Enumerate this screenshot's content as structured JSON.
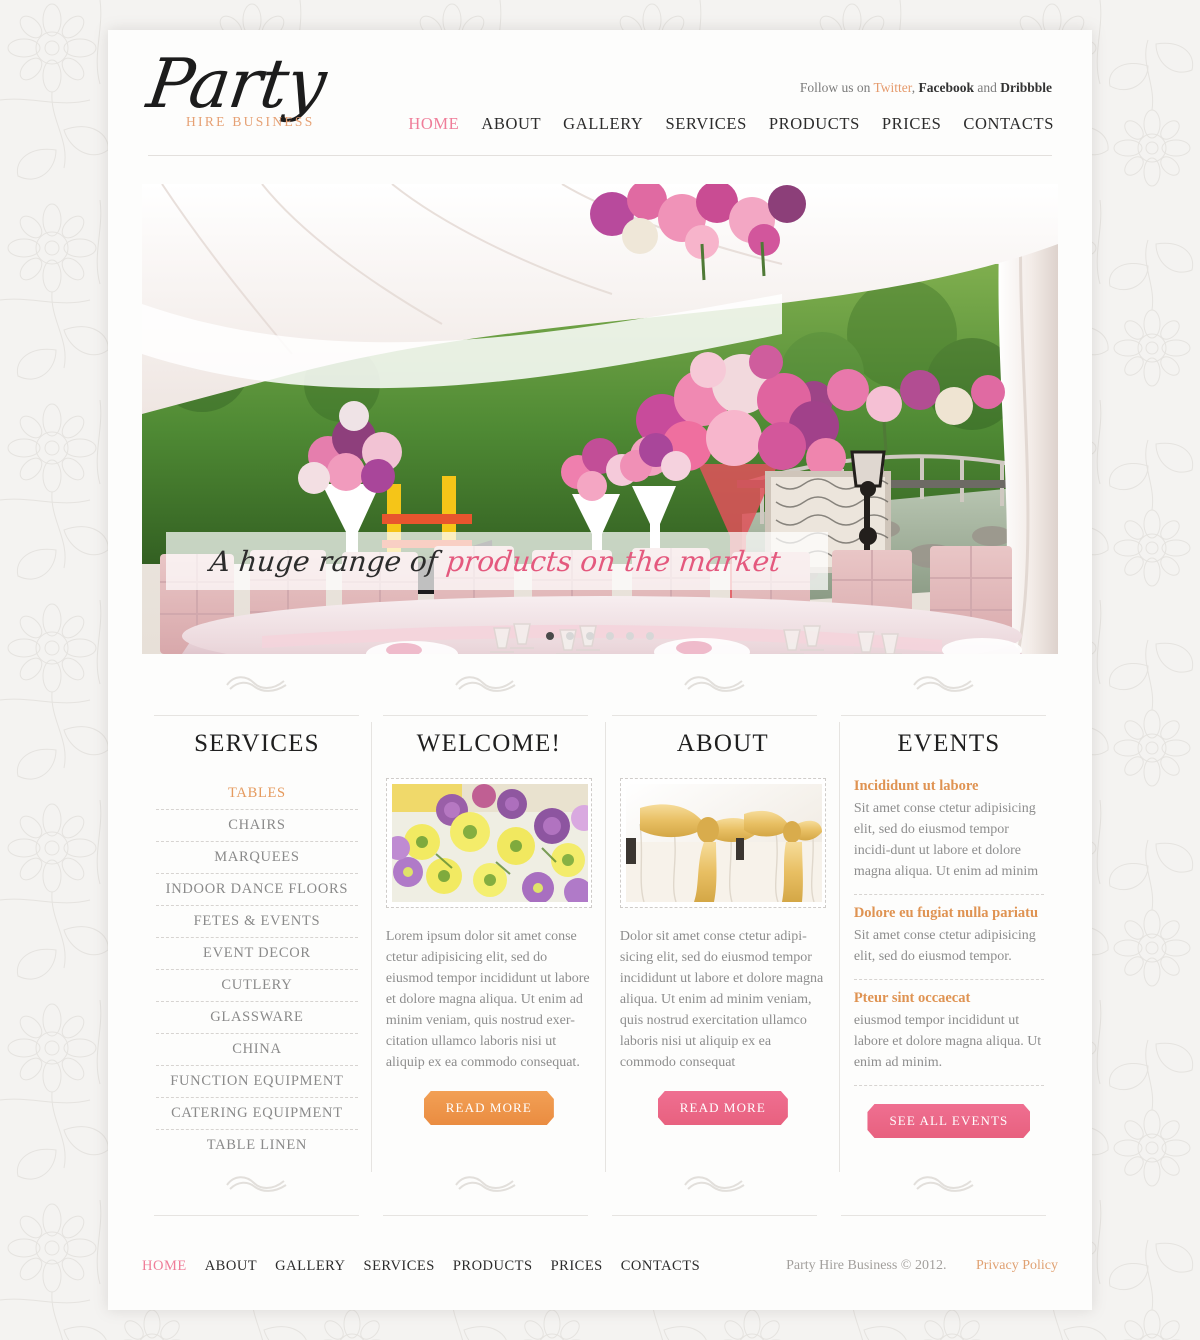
{
  "site": {
    "logo_main": "Party",
    "logo_sub": "HIRE BUSINESS"
  },
  "header": {
    "social_prefix": "Follow us on ",
    "social_twitter": "Twitter",
    "social_comma": ", ",
    "social_facebook": "Facebook",
    "social_and": " and ",
    "social_dribbble": "Dribbble",
    "nav": [
      {
        "label": "HOME",
        "active": true
      },
      {
        "label": "ABOUT",
        "active": false
      },
      {
        "label": "GALLERY",
        "active": false
      },
      {
        "label": "SERVICES",
        "active": false
      },
      {
        "label": "PRODUCTS",
        "active": false
      },
      {
        "label": "PRICES",
        "active": false
      },
      {
        "label": "CONTACTS",
        "active": false
      }
    ]
  },
  "slider": {
    "caption_dark": "A huge range of ",
    "caption_pink": "products on the market",
    "dot_count": 6,
    "active_dot": 1,
    "image_alt": "outdoor-wedding-marquee-table-setting"
  },
  "services": {
    "title": "SERVICES",
    "items": [
      {
        "label": "TABLES",
        "active": true
      },
      {
        "label": "CHAIRS",
        "active": false
      },
      {
        "label": "MARQUEES",
        "active": false
      },
      {
        "label": "INDOOR DANCE FLOORS",
        "active": false
      },
      {
        "label": "FETES & EVENTS",
        "active": false
      },
      {
        "label": "EVENT DECOR",
        "active": false
      },
      {
        "label": "CUTLERY",
        "active": false
      },
      {
        "label": "GLASSWARE",
        "active": false
      },
      {
        "label": "CHINA",
        "active": false
      },
      {
        "label": "FUNCTION EQUIPMENT",
        "active": false
      },
      {
        "label": "CATERING EQUIPMENT",
        "active": false
      },
      {
        "label": "TABLE LINEN",
        "active": false
      }
    ]
  },
  "welcome": {
    "title": "WELCOME!",
    "image_alt": "yellow-and-purple-flower-bouquet",
    "text": "Lorem ipsum dolor sit amet conse ctetur adipisicing elit, sed do eiusmod tempor incididunt ut labore et dolore magna aliqua. Ut enim ad minim veniam, quis nostrud exer-citation ullamco laboris nisi ut aliquip ex ea commodo consequat.",
    "button": "READ MORE"
  },
  "about": {
    "title": "ABOUT",
    "image_alt": "gold-satin-bows-on-chair-covers",
    "text": "Dolor sit amet conse ctetur adipi-sicing elit, sed do eiusmod tempor incididunt ut labore et dolore magna aliqua. Ut enim ad minim veniam, quis nostrud exercitation ullamco laboris nisi ut aliquip ex ea commodo consequat",
    "button": "READ MORE"
  },
  "events": {
    "title": "EVENTS",
    "items": [
      {
        "heading": "Incididunt ut labore",
        "text": "Sit amet conse ctetur adipisicing elit, sed do eiusmod tempor incidi-dunt ut labore et dolore magna aliqua. Ut enim ad minim"
      },
      {
        "heading": "Dolore eu fugiat nulla pariatu",
        "text": "Sit amet conse ctetur adipisicing elit, sed do eiusmod tempor."
      },
      {
        "heading": "Pteur sint occaecat",
        "text": "eiusmod tempor incididunt ut labore et dolore magna aliqua. Ut enim ad minim."
      }
    ],
    "button": "SEE ALL EVENTS"
  },
  "footer": {
    "nav": [
      {
        "label": "HOME",
        "active": true
      },
      {
        "label": "ABOUT",
        "active": false
      },
      {
        "label": "GALLERY",
        "active": false
      },
      {
        "label": "SERVICES",
        "active": false
      },
      {
        "label": "PRODUCTS",
        "active": false
      },
      {
        "label": "PRICES",
        "active": false
      },
      {
        "label": "CONTACTS",
        "active": false
      }
    ],
    "copyright": "Party Hire Business  © 2012.",
    "privacy": "Privacy Policy"
  },
  "colors": {
    "pink": "#ef7d99",
    "orange": "#e59a5e",
    "text_grey": "#8d8d8d",
    "dark": "#1f1f1f"
  }
}
